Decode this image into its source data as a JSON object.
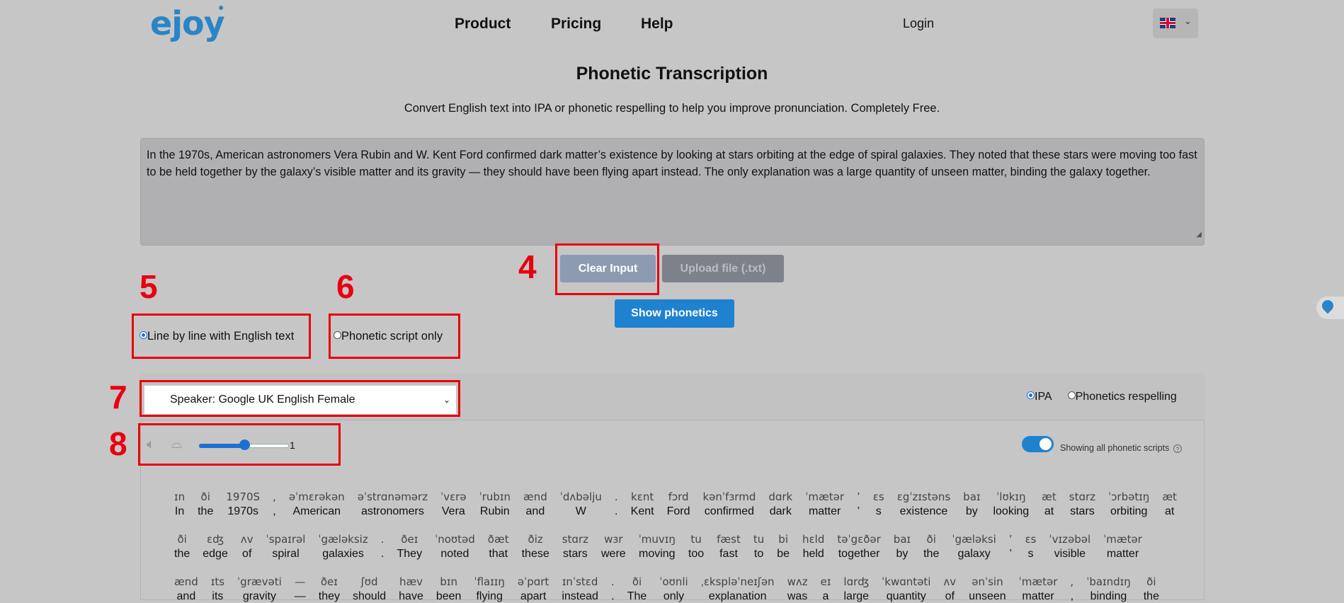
{
  "header": {
    "logo": "ejoy",
    "nav": [
      "Product",
      "Pricing",
      "Help"
    ],
    "login": "Login",
    "lang_flag": "uk-flag-icon"
  },
  "page": {
    "title": "Phonetic Transcription",
    "subtitle": "Convert English text into IPA or phonetic respelling to help you improve pronunciation. Completely Free."
  },
  "input": {
    "text": "In the 1970s, American astronomers Vera Rubin and W. Kent Ford confirmed dark matter’s existence by looking at stars orbiting at the edge of spiral galaxies. They noted that these stars were moving too fast to be held together by the galaxy’s visible matter and its gravity — they should have been flying apart instead. The only explanation was a large quantity of unseen matter, binding the galaxy together."
  },
  "buttons": {
    "clear": "Clear Input",
    "upload": "Upload file (.txt)",
    "show": "Show phonetics"
  },
  "annotations": [
    "4",
    "5",
    "6",
    "7",
    "8"
  ],
  "display_options": {
    "line_by_line": "Line by line with English text",
    "script_only": "Phonetic script only",
    "selected": "Line by line with English text"
  },
  "speaker": {
    "selected": "Speaker: Google UK English Female"
  },
  "notation": {
    "ipa": "IPA",
    "respelling": "Phonetics respelling",
    "selected": "IPA"
  },
  "audio": {
    "speed": "1",
    "speed_fraction": 0.5
  },
  "toggle": {
    "label": "Showing all phonetic scripts",
    "on": true
  },
  "colors": {
    "accent": "#1f82cf",
    "annotation_red": "#e8000f",
    "logo_blue": "#2a84c7"
  },
  "transcription": [
    [
      [
        "ɪn",
        "In"
      ],
      [
        "ði",
        "the"
      ],
      [
        "1970S",
        "1970s"
      ],
      [
        ",",
        ","
      ],
      [
        "əˈmɛrəkən",
        "American"
      ],
      [
        "əˈstrɑnəmərz",
        "astronomers"
      ],
      [
        "ˈvɛrə",
        "Vera"
      ],
      [
        "ˈrubɪn",
        "Rubin"
      ],
      [
        "ænd",
        "and"
      ],
      [
        "ˈdʌbəlju",
        "W"
      ],
      [
        ".",
        "."
      ],
      [
        "kɛnt",
        "Kent"
      ],
      [
        "fɔrd",
        "Ford"
      ],
      [
        "kənˈfɜrmd",
        "confirmed"
      ],
      [
        "dɑrk",
        "dark"
      ],
      [
        "ˈmætər",
        "matter"
      ],
      [
        "’",
        "’"
      ],
      [
        "ɛs",
        "s"
      ],
      [
        "ɛgˈzɪstəns",
        "existence"
      ],
      [
        "baɪ",
        "by"
      ],
      [
        "ˈlʊkɪŋ",
        "looking"
      ],
      [
        "æt",
        "at"
      ],
      [
        "stɑrz",
        "stars"
      ],
      [
        "ˈɔrbətɪŋ",
        "orbiting"
      ],
      [
        "æt",
        "at"
      ]
    ],
    [
      [
        "ði",
        "the"
      ],
      [
        "ɛʤ",
        "edge"
      ],
      [
        "ʌv",
        "of"
      ],
      [
        "ˈspaɪrəl",
        "spiral"
      ],
      [
        "ˈgæləksiz",
        "galaxies"
      ],
      [
        ".",
        "."
      ],
      [
        "ðeɪ",
        "They"
      ],
      [
        "ˈnoʊtəd",
        "noted"
      ],
      [
        "ðæt",
        "that"
      ],
      [
        "ðiz",
        "these"
      ],
      [
        "stɑrz",
        "stars"
      ],
      [
        "wɜr",
        "were"
      ],
      [
        "ˈmuvɪŋ",
        "moving"
      ],
      [
        "tu",
        "too"
      ],
      [
        "fæst",
        "fast"
      ],
      [
        "tu",
        "to"
      ],
      [
        "bi",
        "be"
      ],
      [
        "hɛld",
        "held"
      ],
      [
        "təˈgɛðər",
        "together"
      ],
      [
        "baɪ",
        "by"
      ],
      [
        "ði",
        "the"
      ],
      [
        "ˈgæləksi",
        "galaxy"
      ],
      [
        "’",
        "’"
      ],
      [
        "ɛs",
        "s"
      ],
      [
        "ˈvɪzəbəl",
        "visible"
      ],
      [
        "ˈmætər",
        "matter"
      ]
    ],
    [
      [
        "ænd",
        "and"
      ],
      [
        "ɪts",
        "its"
      ],
      [
        "ˈgrævəti",
        "gravity"
      ],
      [
        "—",
        "—"
      ],
      [
        "ðeɪ",
        "they"
      ],
      [
        "ʃʊd",
        "should"
      ],
      [
        "hæv",
        "have"
      ],
      [
        "bɪn",
        "been"
      ],
      [
        "ˈflaɪɪŋ",
        "flying"
      ],
      [
        "əˈpɑrt",
        "apart"
      ],
      [
        "ɪnˈstɛd",
        "instead"
      ],
      [
        ".",
        "."
      ],
      [
        "ði",
        "The"
      ],
      [
        "ˈoʊnli",
        "only"
      ],
      [
        "ˌɛkspləˈneɪʃən",
        "explanation"
      ],
      [
        "wʌz",
        "was"
      ],
      [
        "eɪ",
        "a"
      ],
      [
        "lɑrʤ",
        "large"
      ],
      [
        "ˈkwɑntəti",
        "quantity"
      ],
      [
        "ʌv",
        "of"
      ],
      [
        "ənˈsin",
        "unseen"
      ],
      [
        "ˈmætər",
        "matter"
      ],
      [
        ",",
        ","
      ],
      [
        "ˈbaɪndɪŋ",
        "binding"
      ],
      [
        "ði",
        "the"
      ]
    ]
  ]
}
